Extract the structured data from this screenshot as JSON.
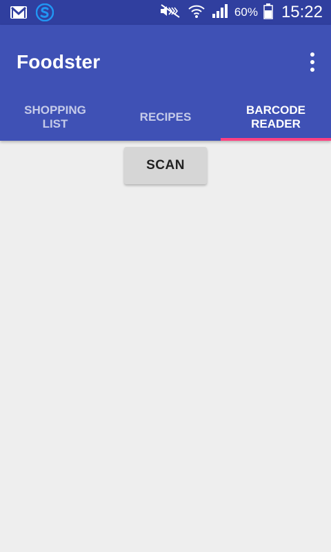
{
  "status_bar": {
    "notification_icons": [
      "gmail-icon",
      "sync-icon"
    ],
    "system_icons": [
      "mute-icon",
      "wifi-icon",
      "signal-icon",
      "battery-icon"
    ],
    "battery_percent": "60%",
    "time": "15:22",
    "background_color": "#303f9f"
  },
  "app_bar": {
    "title": "Foodster",
    "menu_icon": "more-vert-icon",
    "background_color": "#3f51b5"
  },
  "tabs": [
    {
      "label": "SHOPPING LIST",
      "active": false
    },
    {
      "label": "RECIPES",
      "active": false
    },
    {
      "label": "BARCODE READER",
      "active": true
    }
  ],
  "tab_indicator_color": "#ff4081",
  "content": {
    "scan_button_label": "SCAN",
    "background_color": "#eeeeee"
  }
}
